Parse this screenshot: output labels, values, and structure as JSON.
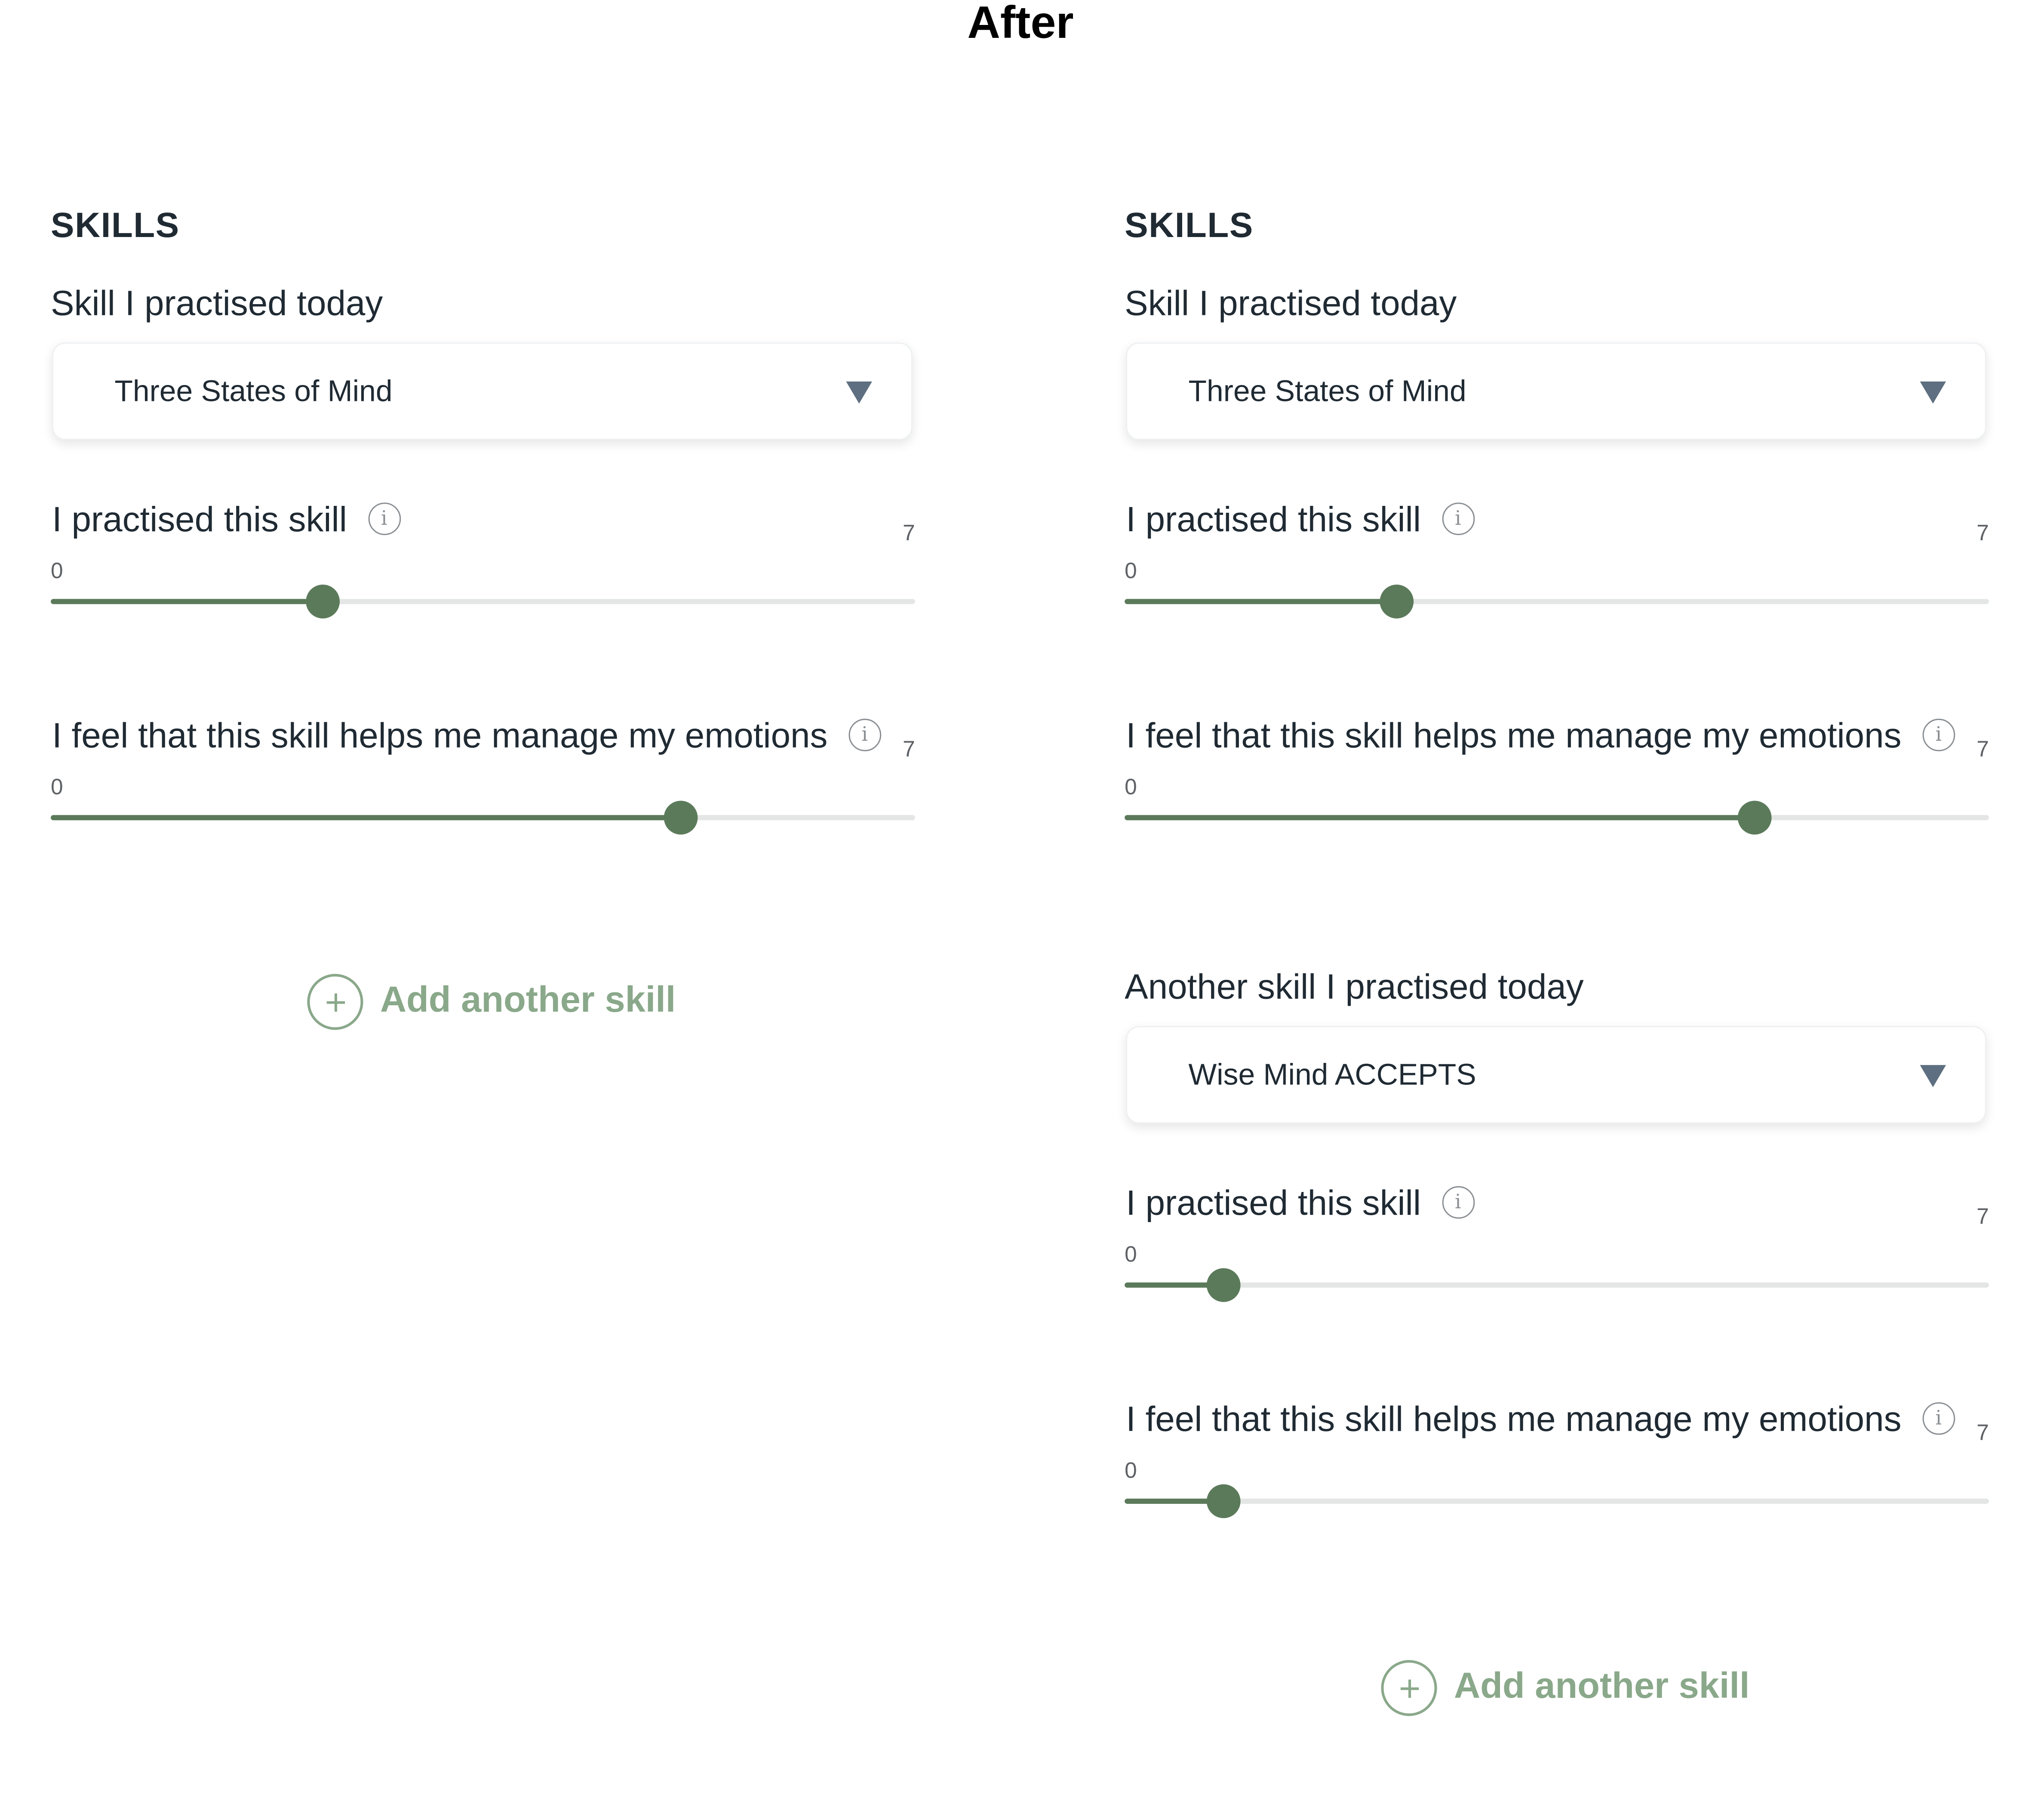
{
  "title": "After",
  "slider_range": {
    "min": 0,
    "max": 7
  },
  "colors": {
    "accent": "#5b7a5a",
    "add_link": "#8aa88a",
    "track": "#e4e5e5",
    "caret": "#5d6f80"
  },
  "panels": [
    {
      "heading": "SKILLS",
      "skills": [
        {
          "label": "Skill I practised today",
          "selected": "Three States of Mind",
          "practised": {
            "label": "I practised this skill",
            "min_label": "0",
            "max_label": "7",
            "value": 2.2
          },
          "helps": {
            "label": "I feel that this skill helps me manage my emotions",
            "min_label": "0",
            "max_label": "7",
            "value": 5.1
          }
        }
      ],
      "add_label": "Add another skill"
    },
    {
      "heading": "SKILLS",
      "skills": [
        {
          "label": "Skill I practised today",
          "selected": "Three States of Mind",
          "practised": {
            "label": "I practised this skill",
            "min_label": "0",
            "max_label": "7",
            "value": 2.2
          },
          "helps": {
            "label": "I feel that this skill helps me manage my emotions",
            "min_label": "0",
            "max_label": "7",
            "value": 5.1
          }
        },
        {
          "label": "Another skill I practised today",
          "selected": "Wise Mind ACCEPTS",
          "practised": {
            "label": "I practised this skill",
            "min_label": "0",
            "max_label": "7",
            "value": 0.8
          },
          "helps": {
            "label": "I feel that this skill helps me manage my emotions",
            "min_label": "0",
            "max_label": "7",
            "value": 0.8
          }
        }
      ],
      "add_label": "Add another skill"
    }
  ]
}
